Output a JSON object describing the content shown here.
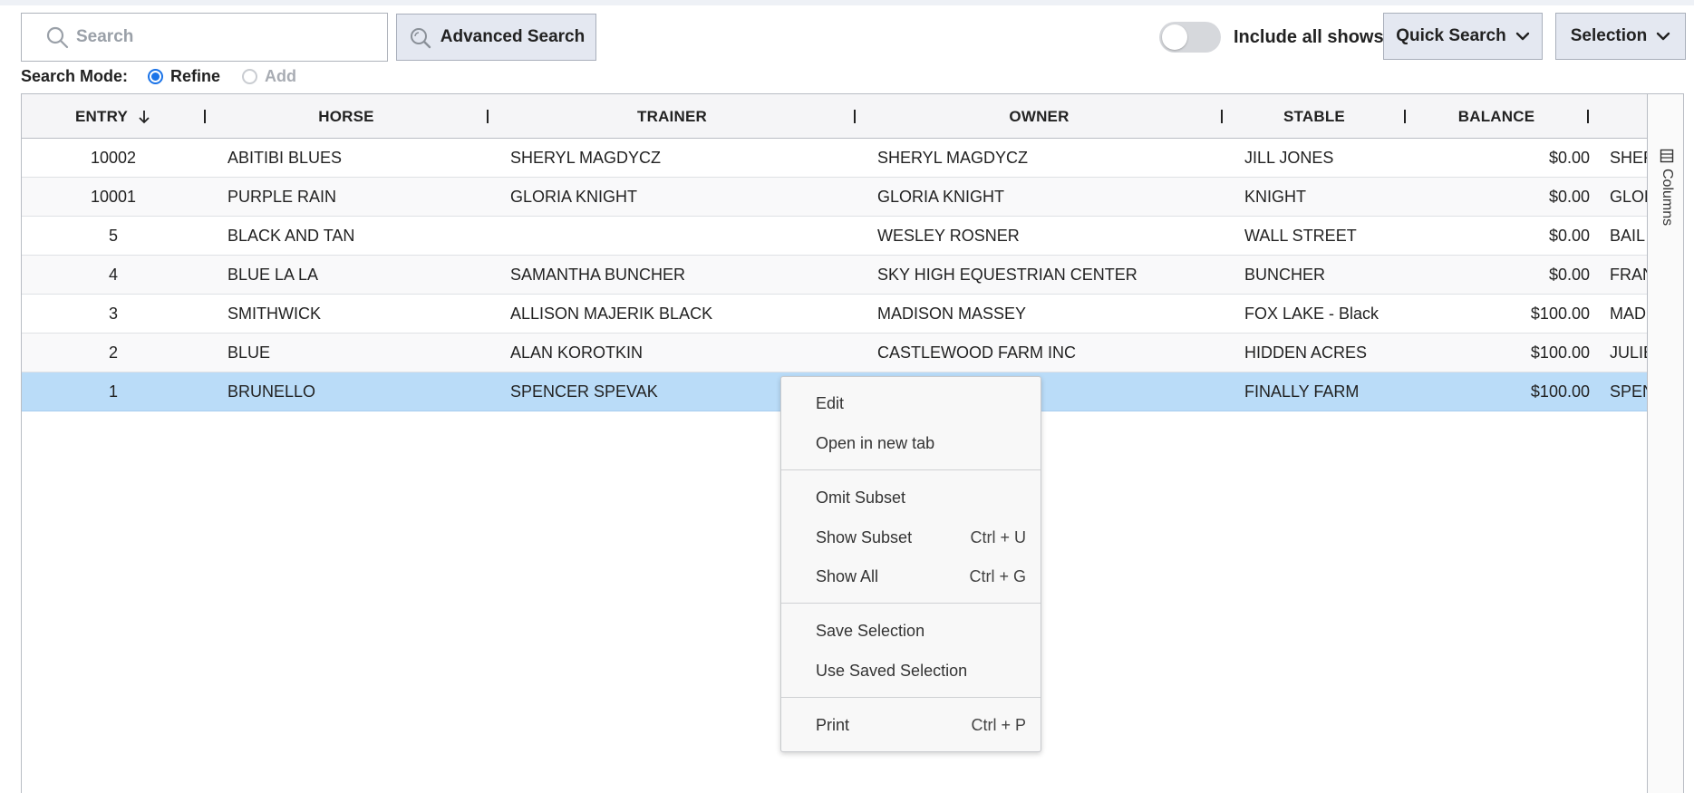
{
  "search": {
    "placeholder": "Search"
  },
  "toolbar": {
    "advanced_search_label": "Advanced Search",
    "include_all_shows_label": "Include all shows",
    "include_all_shows_on": false,
    "quick_search_label": "Quick Search",
    "selection_label": "Selection"
  },
  "search_mode": {
    "label": "Search Mode:",
    "options": [
      {
        "label": "Refine",
        "selected": true,
        "enabled": true
      },
      {
        "label": "Add",
        "selected": false,
        "enabled": false
      }
    ]
  },
  "grid": {
    "columns": [
      "ENTRY",
      "HORSE",
      "TRAINER",
      "OWNER",
      "STABLE",
      "BALANCE"
    ],
    "sort": {
      "column": "ENTRY",
      "direction": "descending"
    },
    "rows": [
      {
        "entry": "10002",
        "horse": "ABITIBI BLUES",
        "trainer": "SHERYL MAGDYCZ",
        "owner": "SHERYL MAGDYCZ",
        "stable": "JILL JONES",
        "balance": "$0.00",
        "extra": "SHER"
      },
      {
        "entry": "10001",
        "horse": "PURPLE RAIN",
        "trainer": "GLORIA KNIGHT",
        "owner": "GLORIA KNIGHT",
        "stable": "KNIGHT",
        "balance": "$0.00",
        "extra": "GLOR"
      },
      {
        "entry": "5",
        "horse": "BLACK AND TAN",
        "trainer": "",
        "owner": "WESLEY ROSNER",
        "stable": "WALL STREET",
        "balance": "$0.00",
        "extra": "BAIL"
      },
      {
        "entry": "4",
        "horse": "BLUE LA LA",
        "trainer": "SAMANTHA BUNCHER",
        "owner": "SKY HIGH EQUESTRIAN CENTER",
        "stable": "BUNCHER",
        "balance": "$0.00",
        "extra": "FRAN"
      },
      {
        "entry": "3",
        "horse": "SMITHWICK",
        "trainer": "ALLISON MAJERIK BLACK",
        "owner": "MADISON MASSEY",
        "stable": "FOX LAKE - Black",
        "balance": "$100.00",
        "extra": "MAD"
      },
      {
        "entry": "2",
        "horse": "BLUE",
        "trainer": "ALAN KOROTKIN",
        "owner": "CASTLEWOOD FARM INC",
        "stable": "HIDDEN ACRES",
        "balance": "$100.00",
        "extra": "JULIE"
      },
      {
        "entry": "1",
        "horse": "BRUNELLO",
        "trainer": "SPENCER SPEVAK",
        "owner": "",
        "stable": "FINALLY FARM",
        "balance": "$100.00",
        "extra": "SPEN",
        "selected": true
      }
    ],
    "side_panel_label": "Columns"
  },
  "context_menu": {
    "items": [
      {
        "label": "Edit",
        "shortcut": ""
      },
      {
        "label": "Open in new tab",
        "shortcut": ""
      },
      {
        "label": "Omit Subset",
        "shortcut": ""
      },
      {
        "label": "Show Subset",
        "shortcut": "Ctrl + U"
      },
      {
        "label": "Show All",
        "shortcut": "Ctrl + G"
      },
      {
        "label": "Save Selection",
        "shortcut": ""
      },
      {
        "label": "Use Saved Selection",
        "shortcut": ""
      },
      {
        "label": "Print",
        "shortcut": "Ctrl + P"
      }
    ]
  },
  "colors": {
    "selected_row": "#badcf8",
    "button_bg": "#e4e8f1",
    "radio_accent": "#1a73e8"
  }
}
